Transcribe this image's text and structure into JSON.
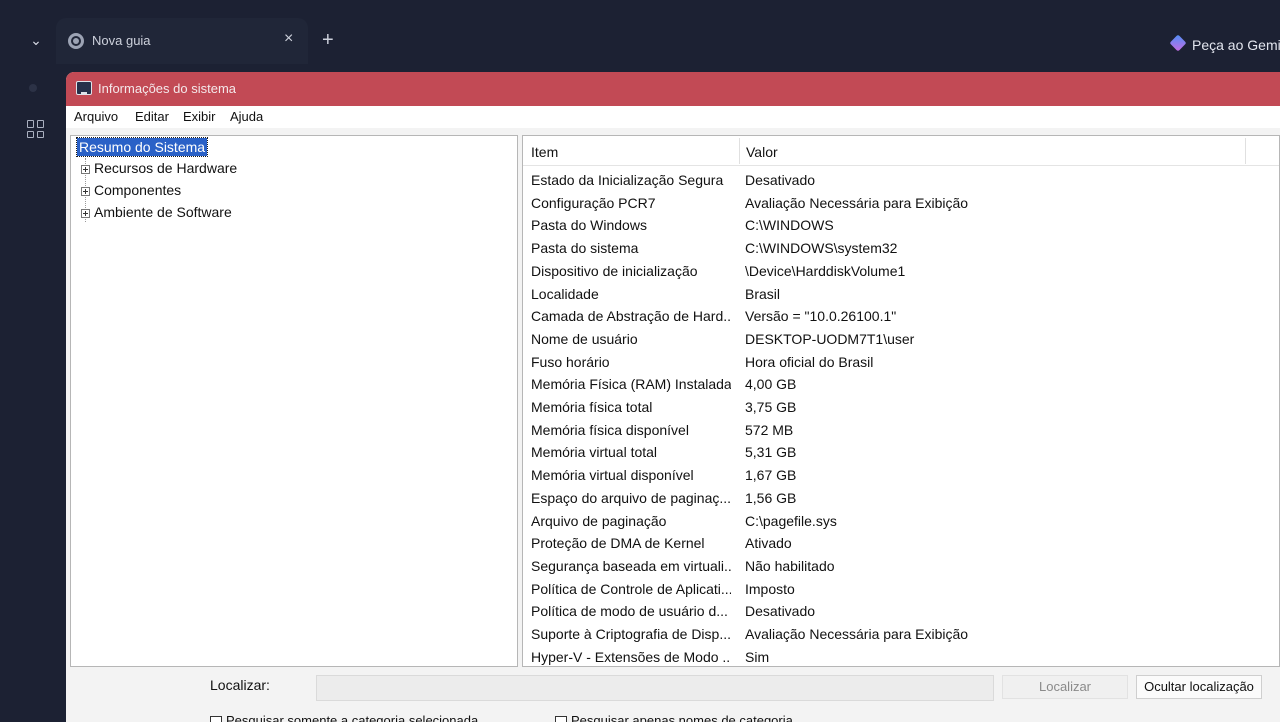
{
  "browser": {
    "tab_menu_icon": "chevron-down-icon",
    "tab_title": "Nova guia",
    "tab_close": "×",
    "new_tab": "+",
    "gemini_label": "Peça ao Gemini"
  },
  "window": {
    "title": "Informações do sistema",
    "title_color": "#c24a55",
    "menu": [
      "Arquivo",
      "Editar",
      "Exibir",
      "Ajuda"
    ]
  },
  "tree": {
    "root": "Resumo do Sistema",
    "nodes": [
      "Recursos de Hardware",
      "Componentes",
      "Ambiente de Software"
    ]
  },
  "list": {
    "headers": {
      "item": "Item",
      "value": "Valor"
    },
    "rows": [
      {
        "item": "Estado da Inicialização Segura",
        "value": "Desativado"
      },
      {
        "item": "Configuração PCR7",
        "value": "Avaliação Necessária para Exibição"
      },
      {
        "item": "Pasta do Windows",
        "value": "C:\\WINDOWS"
      },
      {
        "item": "Pasta do sistema",
        "value": "C:\\WINDOWS\\system32"
      },
      {
        "item": "Dispositivo de inicialização",
        "value": "\\Device\\HarddiskVolume1"
      },
      {
        "item": "Localidade",
        "value": "Brasil"
      },
      {
        "item": "Camada de Abstração de Hard...",
        "value": "Versão = \"10.0.26100.1\""
      },
      {
        "item": "Nome de usuário",
        "value": "DESKTOP-UODM7T1\\user"
      },
      {
        "item": "Fuso horário",
        "value": "Hora oficial do Brasil"
      },
      {
        "item": "Memória Física (RAM) Instalada",
        "value": "4,00 GB"
      },
      {
        "item": "Memória física total",
        "value": "3,75 GB"
      },
      {
        "item": "Memória física disponível",
        "value": "572 MB"
      },
      {
        "item": "Memória virtual total",
        "value": "5,31 GB"
      },
      {
        "item": "Memória virtual disponível",
        "value": "1,67 GB"
      },
      {
        "item": "Espaço do arquivo de paginaç...",
        "value": "1,56 GB"
      },
      {
        "item": "Arquivo de paginação",
        "value": "C:\\pagefile.sys"
      },
      {
        "item": "Proteção de DMA de Kernel",
        "value": "Ativado"
      },
      {
        "item": "Segurança baseada em virtuali...",
        "value": "Não habilitado"
      },
      {
        "item": "Política de Controle de Aplicati...",
        "value": "Imposto"
      },
      {
        "item": "Política de modo de usuário d...",
        "value": "Desativado"
      },
      {
        "item": "Suporte à Criptografia de Disp...",
        "value": "Avaliação Necessária para Exibição"
      },
      {
        "item": "Hyper-V - Extensões de Modo ...",
        "value": "Sim"
      }
    ]
  },
  "find": {
    "label": "Localizar:",
    "value": "",
    "find_button": "Localizar",
    "hide_button": "Ocultar localização",
    "check_selected": "Pesquisar somente a categoria selecionada",
    "check_names": "Pesquisar apenas nomes de categoria"
  }
}
